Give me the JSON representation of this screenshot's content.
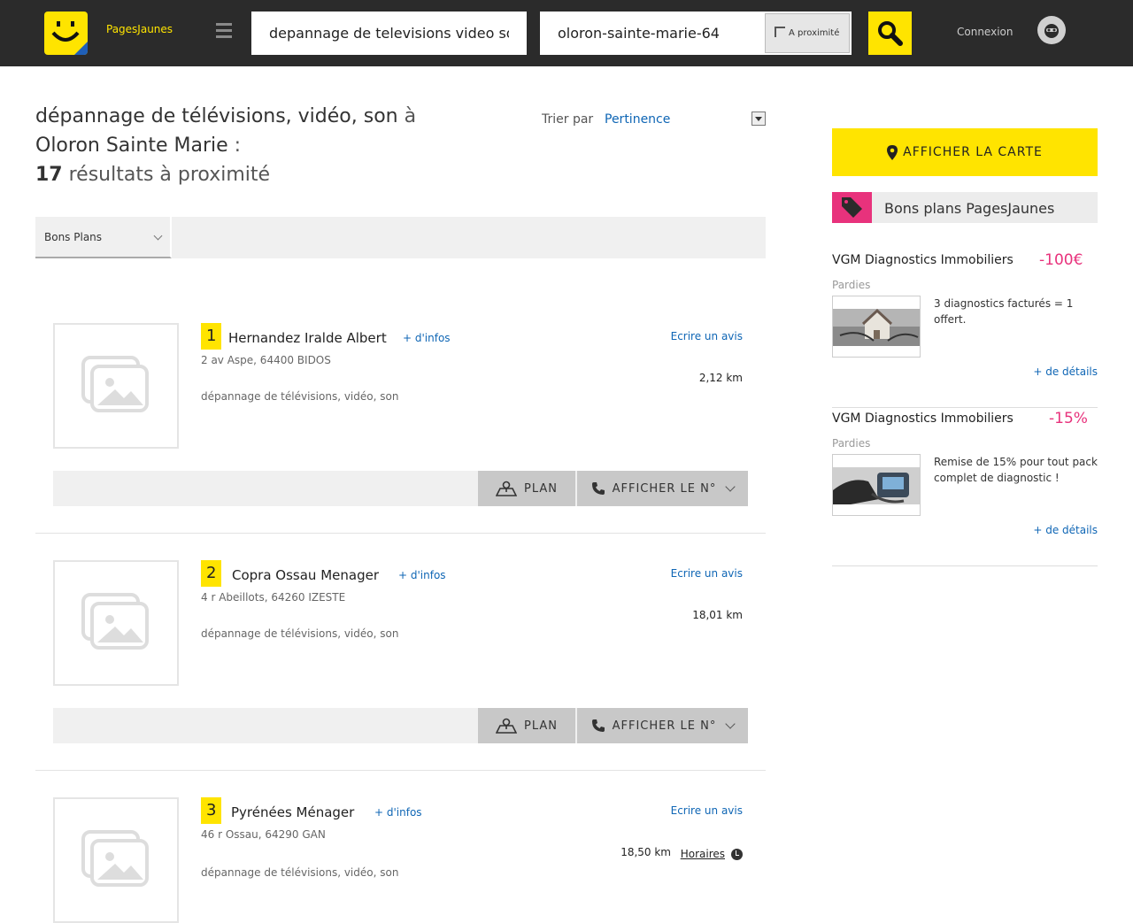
{
  "header": {
    "brand": "PagesJaunes",
    "search_what": "depannage de televisions video son",
    "search_where": "oloron-sainte-marie-64",
    "proximity_label": "A proximité",
    "login": "Connexion",
    "colors": {
      "bar": "#2b2b2b",
      "accent": "#ffe400"
    }
  },
  "results": {
    "query": "dépannage de télévisions, vidéo, son",
    "preposition": "à",
    "city": "Oloron Sainte Marie",
    "colon": ":",
    "count": "17",
    "count_label": "résultats à proximité",
    "sort_label": "Trier par",
    "sort_value": "Pertinence",
    "filter_label": "Bons Plans"
  },
  "listings": [
    {
      "rank": "1",
      "name": "Hernandez Iralde Albert",
      "more": "+ d'infos",
      "review": "Ecrire un avis",
      "address": "2 av Aspe, 64400 BIDOS",
      "distance": "2,12 km",
      "category": "dépannage de télévisions, vidéo, son",
      "plan": "PLAN",
      "phone": "AFFICHER LE N°"
    },
    {
      "rank": "2",
      "name": "Copra Ossau Menager",
      "more": "+ d'infos",
      "review": "Ecrire un avis",
      "address": "4 r Abeillots, 64260 IZESTE",
      "distance": "18,01 km",
      "category": "dépannage de télévisions, vidéo, son",
      "plan": "PLAN",
      "phone": "AFFICHER LE N°"
    },
    {
      "rank": "3",
      "name": "Pyrénées Ménager",
      "more": "+ d'infos",
      "review": "Ecrire un avis",
      "address": "46 r Ossau, 64290 GAN",
      "distance": "18,50 km",
      "hours": "Horaires",
      "category": "dépannage de télévisions, vidéo, son"
    }
  ],
  "sidebar": {
    "map_button": "AFFICHER LA CARTE",
    "deals_title": "Bons plans PagesJaunes",
    "deals": [
      {
        "name": "VGM Diagnostics Immobiliers",
        "discount": "-100€",
        "place": "Pardies",
        "description": "3 diagnostics facturés = 1 offert.",
        "more": "+ de détails"
      },
      {
        "name": "VGM Diagnostics Immobiliers",
        "discount": "-15%",
        "place": "Pardies",
        "description": "Remise de 15% pour tout pack complet de diagnostic !",
        "more": "+ de détails"
      }
    ],
    "colors": {
      "deal": "#e8327c",
      "link": "#0f66b5"
    }
  }
}
